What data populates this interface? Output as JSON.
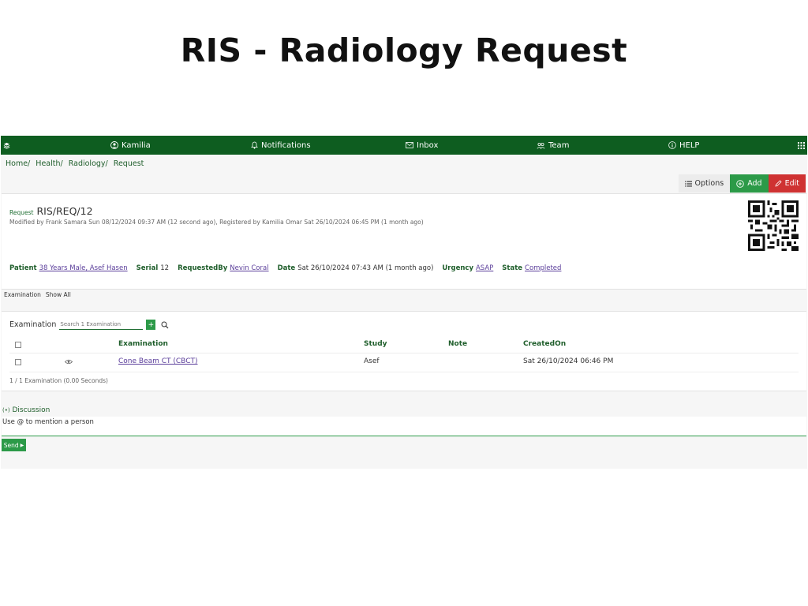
{
  "heading": "RIS - Radiology Request",
  "topbar": {
    "menu_icon": "layers-icon",
    "user": "Kamilia",
    "notifications": "Notifications",
    "inbox": "Inbox",
    "team": "Team",
    "help": "HELP",
    "apps_icon": "grid-icon",
    "bg_color": "#0e5d20"
  },
  "breadcrumb": [
    "Home/",
    "Health/",
    "Radiology/",
    "Request"
  ],
  "toolbar": {
    "options": "Options",
    "add": "Add",
    "edit": "Edit",
    "add_color": "#2c9a48",
    "edit_color": "#cf3232"
  },
  "request": {
    "label": "Request",
    "id": "RIS/REQ/12",
    "modified": "Modified by Frank Samara Sun 08/12/2024 09:37 AM (12 second ago), Registered by Kamilia Omar Sat 26/10/2024 06:45 PM (1 month ago)",
    "fields": {
      "patient_label": "Patient",
      "patient_value": "38 Years Male, Asef Hasen",
      "serial_label": "Serial",
      "serial_value": "12",
      "requestedby_label": "RequestedBy",
      "requestedby_value": "Nevin Coral",
      "date_label": "Date",
      "date_value": "Sat 26/10/2024 07:43 AM (1 month ago)",
      "urgency_label": "Urgency",
      "urgency_value": "ASAP",
      "state_label": "State",
      "state_value": "Completed"
    }
  },
  "tabs": {
    "examination": "Examination",
    "show_all": "Show All"
  },
  "examination": {
    "title": "Examination",
    "search_placeholder": "Search 1 Examination",
    "plus": "+",
    "columns": [
      "Examination",
      "Study",
      "Note",
      "CreatedOn"
    ],
    "rows": [
      {
        "examination": "Cone Beam CT (CBCT)",
        "study": "Asef",
        "note": "",
        "created_on": "Sat 26/10/2024 06:46 PM"
      }
    ],
    "summary": "1 / 1 Examination (0.00 Seconds)"
  },
  "discussion": {
    "label": "Discussion",
    "placeholder": "Use @ to mention a person",
    "send": "Send"
  }
}
